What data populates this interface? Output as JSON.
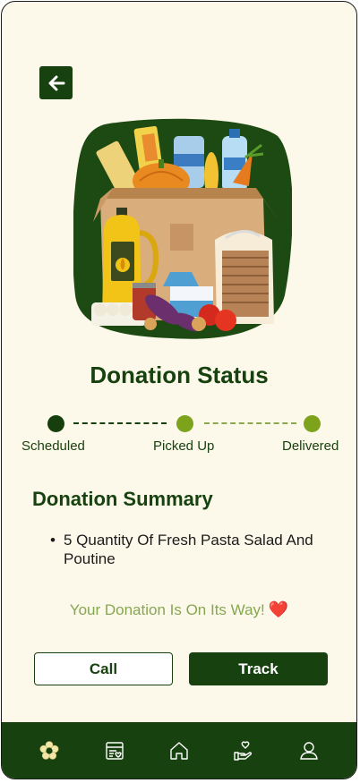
{
  "header": {
    "back_icon": "arrow-left-icon"
  },
  "hero": {
    "image": "grocery-donation-box-illustration"
  },
  "title": "Donation Status",
  "steps": [
    {
      "label": "Scheduled",
      "state": "current",
      "color": "#173f0d"
    },
    {
      "label": "Picked Up",
      "state": "pending",
      "color": "#7da31c"
    },
    {
      "label": "Delivered",
      "state": "pending",
      "color": "#7da31c"
    }
  ],
  "summary": {
    "title": "Donation Summary",
    "items": [
      "5 Quantity Of Fresh Pasta Salad And Poutine"
    ]
  },
  "status_message": "Your Donation Is On Its Way!",
  "status_emoji": "❤️",
  "buttons": {
    "call": "Call",
    "track": "Track"
  },
  "nav": [
    {
      "icon": "flower-icon",
      "active": true
    },
    {
      "icon": "receipt-icon",
      "active": false
    },
    {
      "icon": "home-icon",
      "active": false
    },
    {
      "icon": "hand-heart-icon",
      "active": false
    },
    {
      "icon": "profile-icon",
      "active": false
    }
  ],
  "colors": {
    "primary": "#17420f",
    "accent": "#7da31c",
    "background": "#fdf9ea",
    "message": "#86a752"
  }
}
